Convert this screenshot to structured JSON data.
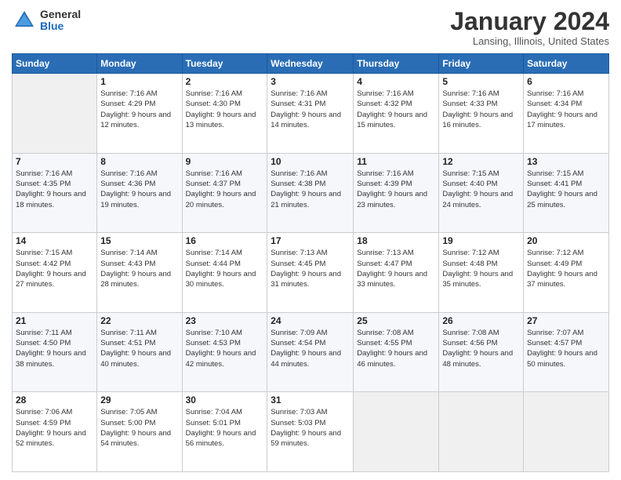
{
  "logo": {
    "general": "General",
    "blue": "Blue"
  },
  "title": "January 2024",
  "location": "Lansing, Illinois, United States",
  "days_of_week": [
    "Sunday",
    "Monday",
    "Tuesday",
    "Wednesday",
    "Thursday",
    "Friday",
    "Saturday"
  ],
  "weeks": [
    [
      {
        "day": "",
        "sunrise": "",
        "sunset": "",
        "daylight": ""
      },
      {
        "day": "1",
        "sunrise": "Sunrise: 7:16 AM",
        "sunset": "Sunset: 4:29 PM",
        "daylight": "Daylight: 9 hours and 12 minutes."
      },
      {
        "day": "2",
        "sunrise": "Sunrise: 7:16 AM",
        "sunset": "Sunset: 4:30 PM",
        "daylight": "Daylight: 9 hours and 13 minutes."
      },
      {
        "day": "3",
        "sunrise": "Sunrise: 7:16 AM",
        "sunset": "Sunset: 4:31 PM",
        "daylight": "Daylight: 9 hours and 14 minutes."
      },
      {
        "day": "4",
        "sunrise": "Sunrise: 7:16 AM",
        "sunset": "Sunset: 4:32 PM",
        "daylight": "Daylight: 9 hours and 15 minutes."
      },
      {
        "day": "5",
        "sunrise": "Sunrise: 7:16 AM",
        "sunset": "Sunset: 4:33 PM",
        "daylight": "Daylight: 9 hours and 16 minutes."
      },
      {
        "day": "6",
        "sunrise": "Sunrise: 7:16 AM",
        "sunset": "Sunset: 4:34 PM",
        "daylight": "Daylight: 9 hours and 17 minutes."
      }
    ],
    [
      {
        "day": "7",
        "sunrise": "Sunrise: 7:16 AM",
        "sunset": "Sunset: 4:35 PM",
        "daylight": "Daylight: 9 hours and 18 minutes."
      },
      {
        "day": "8",
        "sunrise": "Sunrise: 7:16 AM",
        "sunset": "Sunset: 4:36 PM",
        "daylight": "Daylight: 9 hours and 19 minutes."
      },
      {
        "day": "9",
        "sunrise": "Sunrise: 7:16 AM",
        "sunset": "Sunset: 4:37 PM",
        "daylight": "Daylight: 9 hours and 20 minutes."
      },
      {
        "day": "10",
        "sunrise": "Sunrise: 7:16 AM",
        "sunset": "Sunset: 4:38 PM",
        "daylight": "Daylight: 9 hours and 21 minutes."
      },
      {
        "day": "11",
        "sunrise": "Sunrise: 7:16 AM",
        "sunset": "Sunset: 4:39 PM",
        "daylight": "Daylight: 9 hours and 23 minutes."
      },
      {
        "day": "12",
        "sunrise": "Sunrise: 7:15 AM",
        "sunset": "Sunset: 4:40 PM",
        "daylight": "Daylight: 9 hours and 24 minutes."
      },
      {
        "day": "13",
        "sunrise": "Sunrise: 7:15 AM",
        "sunset": "Sunset: 4:41 PM",
        "daylight": "Daylight: 9 hours and 25 minutes."
      }
    ],
    [
      {
        "day": "14",
        "sunrise": "Sunrise: 7:15 AM",
        "sunset": "Sunset: 4:42 PM",
        "daylight": "Daylight: 9 hours and 27 minutes."
      },
      {
        "day": "15",
        "sunrise": "Sunrise: 7:14 AM",
        "sunset": "Sunset: 4:43 PM",
        "daylight": "Daylight: 9 hours and 28 minutes."
      },
      {
        "day": "16",
        "sunrise": "Sunrise: 7:14 AM",
        "sunset": "Sunset: 4:44 PM",
        "daylight": "Daylight: 9 hours and 30 minutes."
      },
      {
        "day": "17",
        "sunrise": "Sunrise: 7:13 AM",
        "sunset": "Sunset: 4:45 PM",
        "daylight": "Daylight: 9 hours and 31 minutes."
      },
      {
        "day": "18",
        "sunrise": "Sunrise: 7:13 AM",
        "sunset": "Sunset: 4:47 PM",
        "daylight": "Daylight: 9 hours and 33 minutes."
      },
      {
        "day": "19",
        "sunrise": "Sunrise: 7:12 AM",
        "sunset": "Sunset: 4:48 PM",
        "daylight": "Daylight: 9 hours and 35 minutes."
      },
      {
        "day": "20",
        "sunrise": "Sunrise: 7:12 AM",
        "sunset": "Sunset: 4:49 PM",
        "daylight": "Daylight: 9 hours and 37 minutes."
      }
    ],
    [
      {
        "day": "21",
        "sunrise": "Sunrise: 7:11 AM",
        "sunset": "Sunset: 4:50 PM",
        "daylight": "Daylight: 9 hours and 38 minutes."
      },
      {
        "day": "22",
        "sunrise": "Sunrise: 7:11 AM",
        "sunset": "Sunset: 4:51 PM",
        "daylight": "Daylight: 9 hours and 40 minutes."
      },
      {
        "day": "23",
        "sunrise": "Sunrise: 7:10 AM",
        "sunset": "Sunset: 4:53 PM",
        "daylight": "Daylight: 9 hours and 42 minutes."
      },
      {
        "day": "24",
        "sunrise": "Sunrise: 7:09 AM",
        "sunset": "Sunset: 4:54 PM",
        "daylight": "Daylight: 9 hours and 44 minutes."
      },
      {
        "day": "25",
        "sunrise": "Sunrise: 7:08 AM",
        "sunset": "Sunset: 4:55 PM",
        "daylight": "Daylight: 9 hours and 46 minutes."
      },
      {
        "day": "26",
        "sunrise": "Sunrise: 7:08 AM",
        "sunset": "Sunset: 4:56 PM",
        "daylight": "Daylight: 9 hours and 48 minutes."
      },
      {
        "day": "27",
        "sunrise": "Sunrise: 7:07 AM",
        "sunset": "Sunset: 4:57 PM",
        "daylight": "Daylight: 9 hours and 50 minutes."
      }
    ],
    [
      {
        "day": "28",
        "sunrise": "Sunrise: 7:06 AM",
        "sunset": "Sunset: 4:59 PM",
        "daylight": "Daylight: 9 hours and 52 minutes."
      },
      {
        "day": "29",
        "sunrise": "Sunrise: 7:05 AM",
        "sunset": "Sunset: 5:00 PM",
        "daylight": "Daylight: 9 hours and 54 minutes."
      },
      {
        "day": "30",
        "sunrise": "Sunrise: 7:04 AM",
        "sunset": "Sunset: 5:01 PM",
        "daylight": "Daylight: 9 hours and 56 minutes."
      },
      {
        "day": "31",
        "sunrise": "Sunrise: 7:03 AM",
        "sunset": "Sunset: 5:03 PM",
        "daylight": "Daylight: 9 hours and 59 minutes."
      },
      {
        "day": "",
        "sunrise": "",
        "sunset": "",
        "daylight": ""
      },
      {
        "day": "",
        "sunrise": "",
        "sunset": "",
        "daylight": ""
      },
      {
        "day": "",
        "sunrise": "",
        "sunset": "",
        "daylight": ""
      }
    ]
  ]
}
